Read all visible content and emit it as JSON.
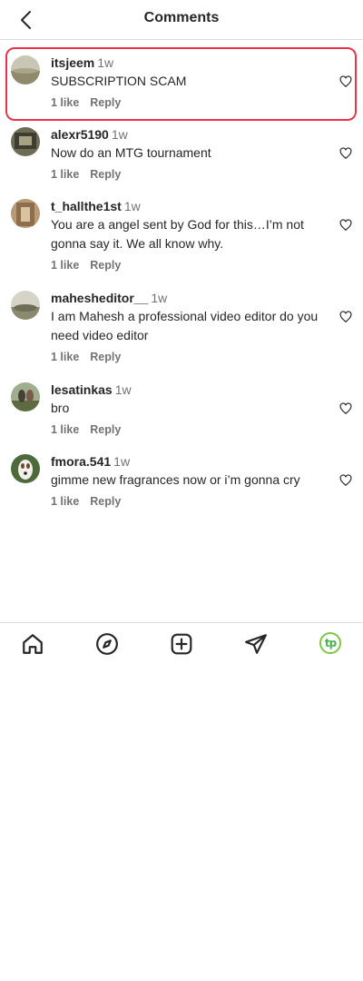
{
  "header": {
    "title": "Comments"
  },
  "comments": [
    {
      "username": "itsjeem",
      "time": "1w",
      "text": "SUBSCRIPTION SCAM",
      "likes": "1 like",
      "reply": "Reply"
    },
    {
      "username": "alexr5190",
      "time": "1w",
      "text": "Now do an MTG tournament",
      "likes": "1 like",
      "reply": "Reply"
    },
    {
      "username": "t_hallthe1st",
      "time": "1w",
      "text": "You are a angel sent by God for this…I’m not gonna say it. We all know why.",
      "likes": "1 like",
      "reply": "Reply"
    },
    {
      "username": "mahesheditor__",
      "time": "1w",
      "text": "I am Mahesh a professional video editor do you need video editor",
      "likes": "1 like",
      "reply": "Reply"
    },
    {
      "username": "lesatinkas",
      "time": "1w",
      "text": "bro",
      "likes": "1 like",
      "reply": "Reply"
    },
    {
      "username": "fmora.541",
      "time": "1w",
      "text": "gimme new fragrances now or i’m gonna cry",
      "likes": "1 like",
      "reply": "Reply"
    }
  ],
  "bottom_nav": {
    "profile_initials": "tp"
  },
  "colors": {
    "highlight": "#e8334a",
    "profile_ring": "#7ac943"
  },
  "icons": [
    "back-arrow-icon",
    "heart-icon",
    "home-icon",
    "explore-compass-icon",
    "create-plus-icon",
    "direct-send-icon"
  ]
}
